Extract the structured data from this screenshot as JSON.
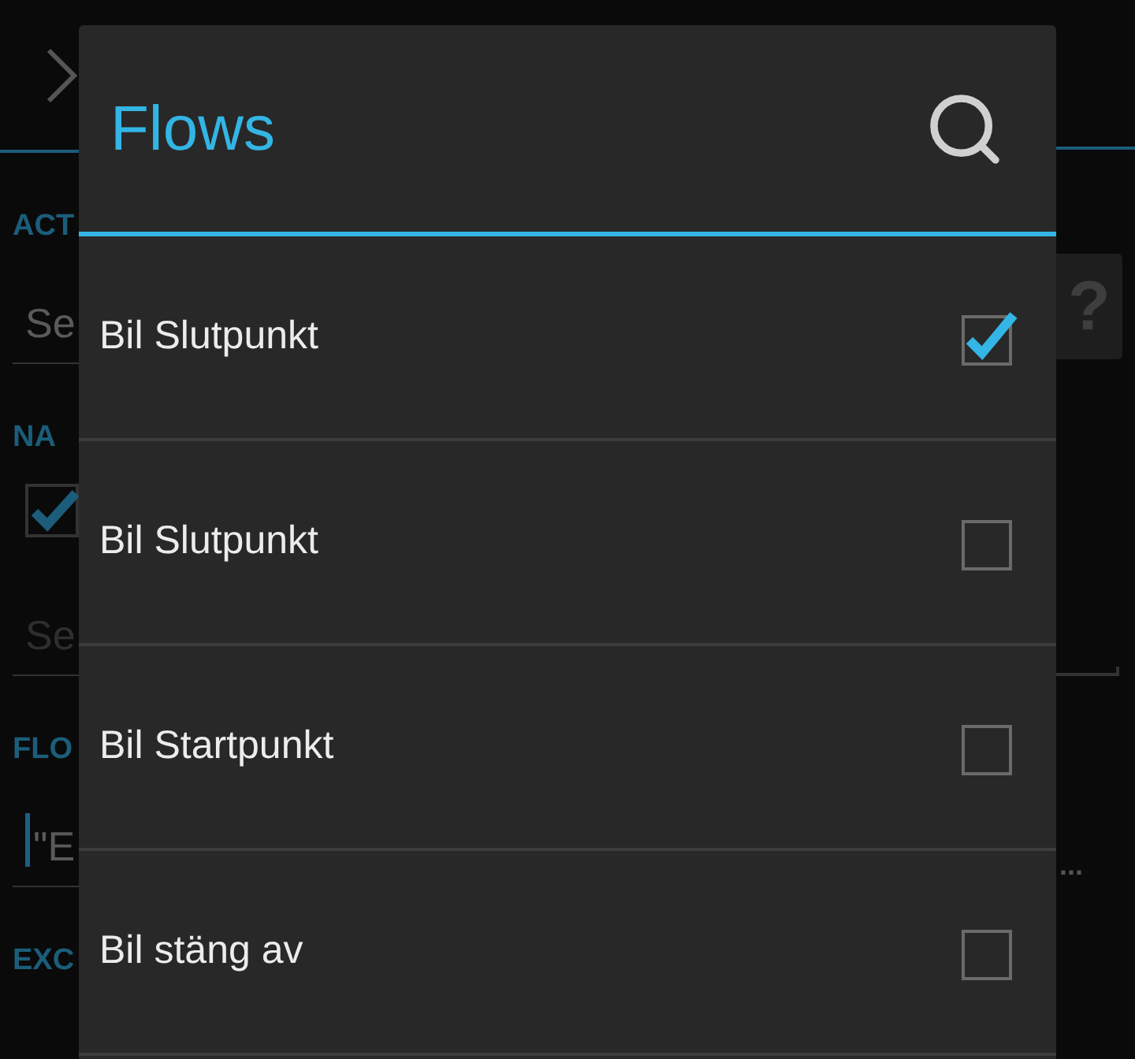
{
  "background": {
    "sections": [
      {
        "kind": "header",
        "text": "ACT"
      },
      {
        "kind": "field",
        "value": "Se",
        "disabled": false,
        "focused": false
      },
      {
        "kind": "header",
        "text": "NA"
      },
      {
        "kind": "checkbox",
        "checked": true
      },
      {
        "kind": "field",
        "value": "Se",
        "disabled": true,
        "focused": false
      },
      {
        "kind": "header",
        "text": "FLO"
      },
      {
        "kind": "field",
        "value": "\"E",
        "disabled": false,
        "focused": true
      },
      {
        "kind": "header",
        "text": "EXC"
      }
    ],
    "help_button": "?",
    "overflow_text": "..."
  },
  "dialog": {
    "title": "Flows",
    "items": [
      {
        "label": "Bil Slutpunkt",
        "checked": true
      },
      {
        "label": "Bil Slutpunkt",
        "checked": false
      },
      {
        "label": "Bil Startpunkt",
        "checked": false
      },
      {
        "label": "Bil stäng av",
        "checked": false
      }
    ]
  }
}
